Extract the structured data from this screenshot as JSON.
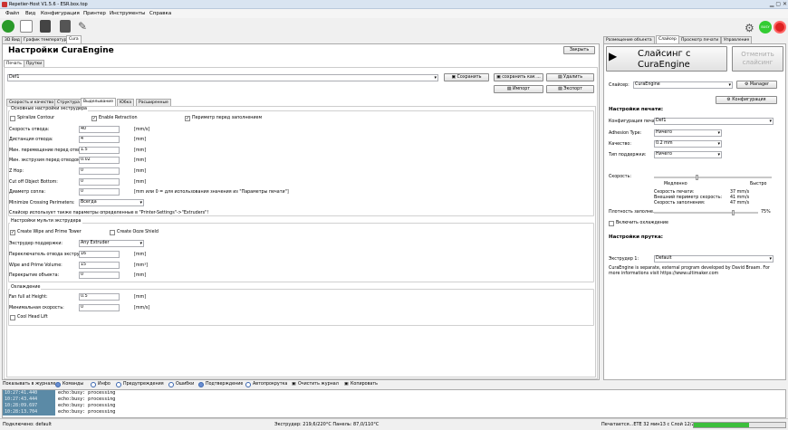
{
  "app": {
    "title": "Repetier-Host V1.5.6 - ESR.box.top"
  },
  "menu": [
    "Файл",
    "Вид",
    "Конфигурация",
    "Принтер",
    "Инструменты",
    "Справка"
  ],
  "status_badge": "BUSY",
  "top_tabs": [
    "3D Вид",
    "График температур",
    "Cura"
  ],
  "left": {
    "title": "Настройки CuraEngine",
    "close": "Закрыть",
    "subtabs": [
      "Печать",
      "Прутки"
    ],
    "profile": "Def1",
    "btn_save": "Сохранить",
    "btn_save_as": "сохранить как ...",
    "btn_delete": "Удалить",
    "btn_import": "Импорт",
    "btn_export": "Экспорт",
    "inner_tabs": [
      "Скорость и качество",
      "Структура",
      "Выделывание",
      "Юбка",
      "Расширенные"
    ],
    "g1_title": "Основные настройки экструдера",
    "spiralize": "Spiralize Contour",
    "enable_retraction": "Enable Retraction",
    "perimeter_before_infill": "Периметр перед заполнением",
    "rows": [
      {
        "label": "Скорость отвода:",
        "value": "40",
        "unit": "[mm/s]"
      },
      {
        "label": "Дистанция отвода:",
        "value": "4",
        "unit": "[mm]"
      },
      {
        "label": "Мин. перемещение перед отводом:",
        "value": "1.5",
        "unit": "[mm]"
      },
      {
        "label": "Мин. экструзия перед отводом:",
        "value": "0.02",
        "unit": "[mm]"
      },
      {
        "label": "Z Hop:",
        "value": "0",
        "unit": "[mm]"
      },
      {
        "label": "Cut off Object Bottom:",
        "value": "0",
        "unit": "[mm]"
      },
      {
        "label": "Диаметр сопла:",
        "value": "0",
        "unit": "[mm или 0 = для использования значения из \"Параметры печати\"]"
      }
    ],
    "minimize_label": "Minimize Crossing Perimeters:",
    "minimize_value": "Всегда",
    "note": "Слайсер использует также параметры определенные в \"Printer-Settings\"->\"Extruders\"!",
    "g2_title": "Настройки мульти экструдера",
    "create_wipe": "Create Wipe and Prime Tower",
    "create_ooze": "Create Ooze Shield",
    "support_extruder_label": "Экструдер поддержки:",
    "support_extruder_value": "Any Extruder",
    "multi_rows": [
      {
        "label": "Переключатель отвода экструдера:",
        "value": "16",
        "unit": "[mm]"
      },
      {
        "label": "Wipe and Prime Volume:",
        "value": "15",
        "unit": "[mm³]"
      },
      {
        "label": "Перекрытие объекта:",
        "value": "0",
        "unit": "[mm]"
      }
    ],
    "g3_title": "Охлаждение",
    "cool_rows": [
      {
        "label": "Fan full at Height:",
        "value": "0.5",
        "unit": "[mm]"
      },
      {
        "label": "Минимальная скорость:",
        "value": "0",
        "unit": "[mm/s]"
      }
    ],
    "cool_head_lift": "Cool Head Lift"
  },
  "right": {
    "tabs": [
      "Размещение объекта",
      "Слайсер",
      "Просмотр печати",
      "Управление"
    ],
    "slice_btn": "Слайсинг с CuraEngine",
    "cancel_btn": "Отменить слайсинг",
    "slicer_label": "Слайсер:",
    "slicer_value": "CuraEngine",
    "manager": "Manager",
    "config": "Конфигурация",
    "print_settings_title": "Настройки печати:",
    "print_config_label": "Конфигурация печати:",
    "print_config_value": "Def1",
    "adhesion_label": "Adhesion Type:",
    "adhesion_value": "Ничего",
    "quality_label": "Качество:",
    "quality_value": "0.2 mm",
    "support_label": "Тип поддержки:",
    "support_value": "Ничего",
    "speed_label": "Скорость:",
    "slow": "Медленно",
    "fast": "Быстро",
    "speed_print_label": "Скорость печати:",
    "speed_print_value": "37 mm/s",
    "speed_outer_label": "Внешний периметр скорость:",
    "speed_outer_value": "41 mm/s",
    "speed_infill_label": "Скорость заполнения:",
    "speed_infill_value": "47 mm/s",
    "density_label": "Плотность заполне...",
    "density_value": "75%",
    "enable_cooling": "Включить охлаждение",
    "filament_title": "Настройки прутка:",
    "extruder1_label": "Экструдер 1:",
    "extruder1_value": "Default",
    "about": "CuraEngine is separate, external program developed by David Braam. For more informations visit https://www.ultimaker.com"
  },
  "log": {
    "show_label": "Показывать в журнале:",
    "filters": [
      "Команды",
      "Инфо",
      "Предупреждения",
      "Ошибки",
      "Подтверждение",
      "Автопрокрутка",
      "Очистить журнал",
      "Копировать"
    ],
    "lines": [
      {
        "time": "10:27:41.440",
        "text": "echo:busy: processing"
      },
      {
        "time": "10:27:43.444",
        "text": "echo:busy: processing"
      },
      {
        "time": "10:28:09.697",
        "text": "echo:busy: processing"
      },
      {
        "time": "10:28:13.704",
        "text": "echo:busy: processing"
      }
    ]
  },
  "status": {
    "connection": "Подключено: default",
    "temps": "Экструдер: 219,6/220°C Панель: 87,0/110°C",
    "progress_text": "Печатается...ETE 32 мин13 с Слой 12/20",
    "progress": 0.6
  }
}
